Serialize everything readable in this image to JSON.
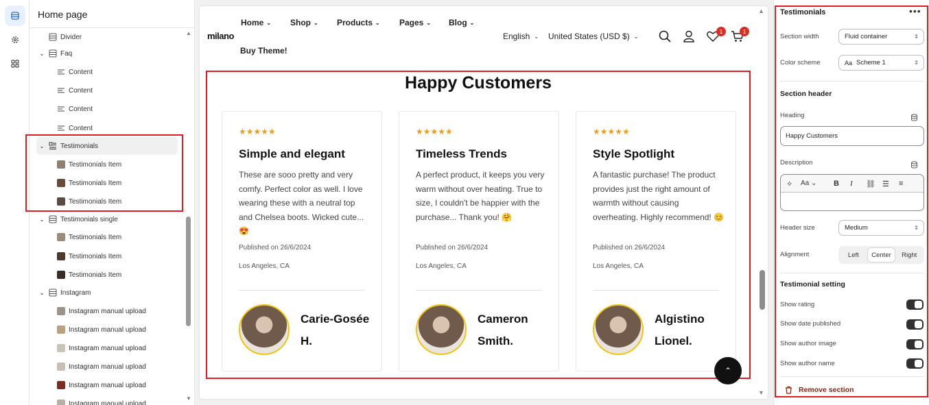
{
  "sidebar": {
    "title": "Home page",
    "items": [
      {
        "label": "Divider",
        "level": 1,
        "icon": "section-icon"
      },
      {
        "label": "Faq",
        "level": 1,
        "icon": "section-icon",
        "expanded": true
      },
      {
        "label": "Content",
        "level": 2,
        "icon": "text-block-icon"
      },
      {
        "label": "Content",
        "level": 2,
        "icon": "text-block-icon"
      },
      {
        "label": "Content",
        "level": 2,
        "icon": "text-block-icon"
      },
      {
        "label": "Content",
        "level": 2,
        "icon": "text-block-icon"
      },
      {
        "label": "Testimonials",
        "level": 1,
        "icon": "testimonial-icon",
        "expanded": true,
        "selected": true
      },
      {
        "label": "Testimonials Item",
        "level": 2,
        "icon": "image-thumb"
      },
      {
        "label": "Testimonials Item",
        "level": 2,
        "icon": "image-thumb"
      },
      {
        "label": "Testimonials Item",
        "level": 2,
        "icon": "image-thumb"
      },
      {
        "label": "Testimonials single",
        "level": 1,
        "icon": "section-icon",
        "expanded": true
      },
      {
        "label": "Testimonials Item",
        "level": 2,
        "icon": "image-thumb"
      },
      {
        "label": "Testimonials Item",
        "level": 2,
        "icon": "image-thumb"
      },
      {
        "label": "Testimonials Item",
        "level": 2,
        "icon": "image-thumb"
      },
      {
        "label": "Instagram",
        "level": 1,
        "icon": "section-icon",
        "expanded": true
      },
      {
        "label": "Instagram manual upload",
        "level": 2,
        "icon": "image-thumb"
      },
      {
        "label": "Instagram manual upload",
        "level": 2,
        "icon": "image-thumb"
      },
      {
        "label": "Instagram manual upload",
        "level": 2,
        "icon": "image-thumb"
      },
      {
        "label": "Instagram manual upload",
        "level": 2,
        "icon": "image-thumb"
      },
      {
        "label": "Instagram manual upload",
        "level": 2,
        "icon": "image-thumb"
      },
      {
        "label": "Instagram manual upload",
        "level": 2,
        "icon": "image-thumb"
      }
    ]
  },
  "preview": {
    "logo": "milano",
    "nav": [
      "Home",
      "Shop",
      "Products",
      "Pages",
      "Blog"
    ],
    "buy_theme": "Buy Theme!",
    "language": "English",
    "currency": "United States (USD $)",
    "wishlist_count": "1",
    "cart_count": "1",
    "section_title": "Happy Customers",
    "cards": [
      {
        "stars": "★★★★★",
        "title": "Simple and elegant",
        "text": "These are sooo pretty and very comfy. Perfect color as well. I love wearing these with a neutral top and Chelsea boots. Wicked cute... 😍",
        "date": "Published on 26/6/2024",
        "location": "Los Angeles, CA",
        "author": "Carie-Gosée H."
      },
      {
        "stars": "★★★★★",
        "title": "Timeless Trends",
        "text": "A perfect product, it keeps you very warm without over heating. True to size, I couldn't be happier with the purchase... Thank you! 🤗",
        "date": "Published on 26/6/2024",
        "location": "Los Angeles, CA",
        "author": "Cameron Smith."
      },
      {
        "stars": "★★★★★",
        "title": "Style Spotlight",
        "text": "A fantastic purchase! The product provides just the right amount of warmth without causing overheating. Highly recommend! 😊",
        "date": "Published on 26/6/2024",
        "location": "Los Angeles, CA",
        "author": "Algistino Lionel."
      }
    ]
  },
  "settings": {
    "title": "Testimonials",
    "section_width_label": "Section width",
    "section_width_value": "Fluid container",
    "color_scheme_label": "Color scheme",
    "color_scheme_value": "Scheme 1",
    "color_scheme_swatch": "Aa",
    "section_header": "Section header",
    "heading_label": "Heading",
    "heading_value": "Happy Customers",
    "description_label": "Description",
    "rte_format": "Aa",
    "header_size_label": "Header size",
    "header_size_value": "Medium",
    "alignment_label": "Alignment",
    "alignment_options": [
      "Left",
      "Center",
      "Right"
    ],
    "alignment_selected": "Center",
    "testimonial_setting": "Testimonial setting",
    "toggles": [
      {
        "label": "Show rating",
        "on": true
      },
      {
        "label": "Show date published",
        "on": true
      },
      {
        "label": "Show author image",
        "on": true
      },
      {
        "label": "Show author name",
        "on": true
      }
    ],
    "remove_label": "Remove section"
  },
  "colors": {
    "highlight": "#e01b24",
    "star": "#f39c12",
    "badge": "#d93025",
    "remove": "#8e1f0b"
  }
}
